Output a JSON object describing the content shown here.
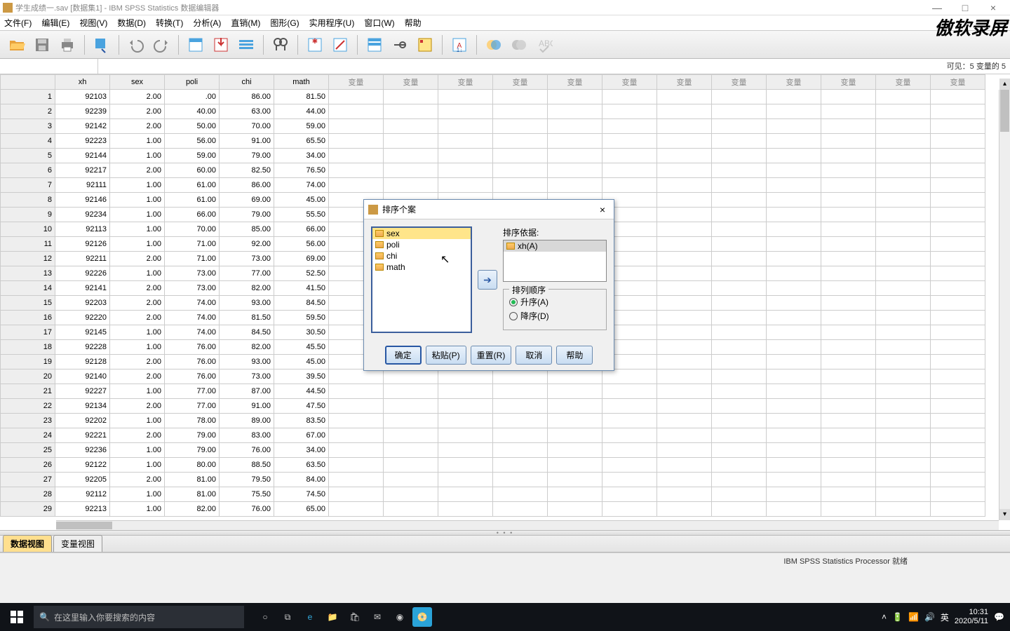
{
  "title": "学生成绩一.sav [数据集1] - IBM SPSS Statistics 数据编辑器",
  "menus": [
    "文件(F)",
    "编辑(E)",
    "视图(V)",
    "数据(D)",
    "转换(T)",
    "分析(A)",
    "直销(M)",
    "图形(G)",
    "实用程序(U)",
    "窗口(W)",
    "帮助"
  ],
  "watermark": "傲软录屏",
  "visible_label": "可见：5 变量的 5",
  "columns": [
    "xh",
    "sex",
    "poli",
    "chi",
    "math"
  ],
  "empty_col_label": "变量",
  "rows": [
    [
      "92103",
      "2.00",
      ".00",
      "86.00",
      "81.50"
    ],
    [
      "92239",
      "2.00",
      "40.00",
      "63.00",
      "44.00"
    ],
    [
      "92142",
      "2.00",
      "50.00",
      "70.00",
      "59.00"
    ],
    [
      "92223",
      "1.00",
      "56.00",
      "91.00",
      "65.50"
    ],
    [
      "92144",
      "1.00",
      "59.00",
      "79.00",
      "34.00"
    ],
    [
      "92217",
      "2.00",
      "60.00",
      "82.50",
      "76.50"
    ],
    [
      "92111",
      "1.00",
      "61.00",
      "86.00",
      "74.00"
    ],
    [
      "92146",
      "1.00",
      "61.00",
      "69.00",
      "45.00"
    ],
    [
      "92234",
      "1.00",
      "66.00",
      "79.00",
      "55.50"
    ],
    [
      "92113",
      "1.00",
      "70.00",
      "85.00",
      "66.00"
    ],
    [
      "92126",
      "1.00",
      "71.00",
      "92.00",
      "56.00"
    ],
    [
      "92211",
      "2.00",
      "71.00",
      "73.00",
      "69.00"
    ],
    [
      "92226",
      "1.00",
      "73.00",
      "77.00",
      "52.50"
    ],
    [
      "92141",
      "2.00",
      "73.00",
      "82.00",
      "41.50"
    ],
    [
      "92203",
      "2.00",
      "74.00",
      "93.00",
      "84.50"
    ],
    [
      "92220",
      "2.00",
      "74.00",
      "81.50",
      "59.50"
    ],
    [
      "92145",
      "1.00",
      "74.00",
      "84.50",
      "30.50"
    ],
    [
      "92228",
      "1.00",
      "76.00",
      "82.00",
      "45.50"
    ],
    [
      "92128",
      "2.00",
      "76.00",
      "93.00",
      "45.00"
    ],
    [
      "92140",
      "2.00",
      "76.00",
      "73.00",
      "39.50"
    ],
    [
      "92227",
      "1.00",
      "77.00",
      "87.00",
      "44.50"
    ],
    [
      "92134",
      "2.00",
      "77.00",
      "91.00",
      "47.50"
    ],
    [
      "92202",
      "1.00",
      "78.00",
      "89.00",
      "83.50"
    ],
    [
      "92221",
      "2.00",
      "79.00",
      "83.00",
      "67.00"
    ],
    [
      "92236",
      "1.00",
      "79.00",
      "76.00",
      "34.00"
    ],
    [
      "92122",
      "1.00",
      "80.00",
      "88.50",
      "63.50"
    ],
    [
      "92205",
      "2.00",
      "81.00",
      "79.50",
      "84.00"
    ],
    [
      "92112",
      "1.00",
      "81.00",
      "75.50",
      "74.50"
    ],
    [
      "92213",
      "1.00",
      "82.00",
      "76.00",
      "65.00"
    ]
  ],
  "tabs": {
    "data": "数据视图",
    "var": "变量视图"
  },
  "status": "IBM SPSS Statistics Processor 就绪",
  "dialog": {
    "title": "排序个案",
    "left_items": [
      "sex",
      "poli",
      "chi",
      "math"
    ],
    "selected_left": "sex",
    "sortby_label": "排序依据:",
    "sortby_items": [
      "xh(A)"
    ],
    "order_legend": "排列顺序",
    "asc": "升序(A)",
    "desc": "降序(D)",
    "btns": {
      "ok": "确定",
      "paste": "粘贴(P)",
      "reset": "重置(R)",
      "cancel": "取消",
      "help": "帮助"
    }
  },
  "taskbar": {
    "search_placeholder": "在这里输入你要搜索的内容",
    "ime": "英",
    "time": "10:31",
    "date": "2020/5/11"
  }
}
